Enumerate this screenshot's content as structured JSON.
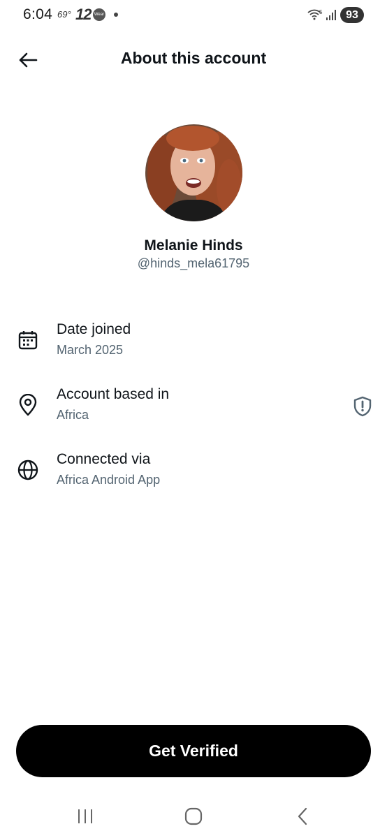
{
  "status_bar": {
    "time": "6:04",
    "temperature": "69°",
    "channel": "12",
    "wear_label": "Wear",
    "network": "5",
    "battery": "93"
  },
  "header": {
    "title": "About this account",
    "back_icon": "arrow-left-icon"
  },
  "profile": {
    "display_name": "Melanie Hinds",
    "handle": "@hinds_mela61795"
  },
  "info": [
    {
      "icon": "calendar-icon",
      "label": "Date joined",
      "value": "March 2025"
    },
    {
      "icon": "location-pin-icon",
      "label": "Account based in",
      "value": "Africa",
      "trailing_icon": "shield-alert-icon"
    },
    {
      "icon": "globe-icon",
      "label": "Connected via",
      "value": "Africa Android App"
    }
  ],
  "cta": {
    "label": "Get Verified"
  },
  "nav": {
    "recent": "recents-icon",
    "home": "home-icon",
    "back": "back-chevron-icon"
  },
  "colors": {
    "primary_text": "#0f1419",
    "secondary_text": "#536471",
    "button_bg": "#000000"
  }
}
